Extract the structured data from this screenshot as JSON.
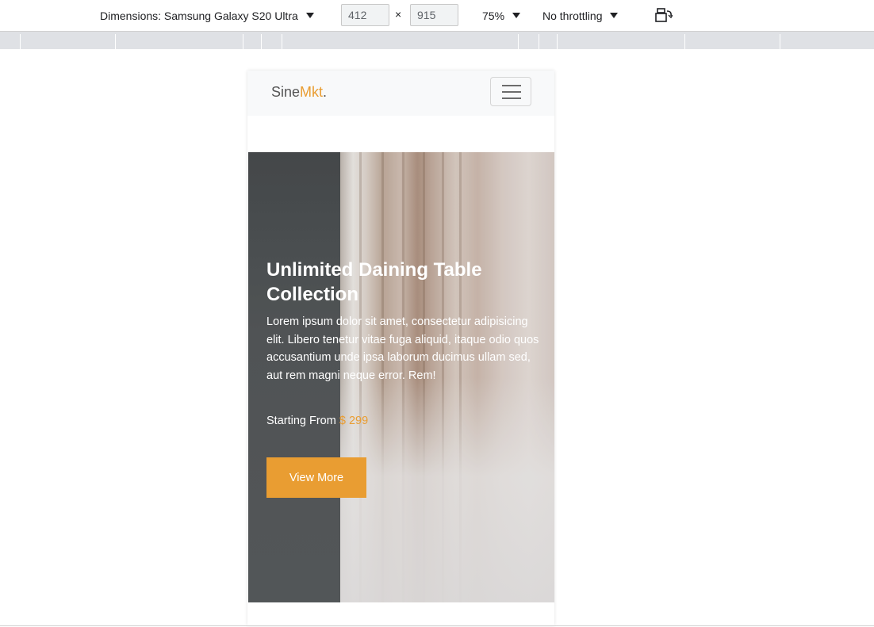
{
  "toolbar": {
    "dimensions_label": "Dimensions: Samsung Galaxy S20 Ultra",
    "width": "412",
    "times": "×",
    "height": "915",
    "zoom": "75%",
    "throttling": "No throttling",
    "rotate_icon": "rotate-icon"
  },
  "page": {
    "brand_main": "Sine",
    "brand_accent": "Mkt",
    "brand_dot": ".",
    "hero": {
      "title": "Unlimited Daining Table Collection",
      "text": "Lorem ipsum dolor sit amet, consectetur adipisicing elit. Libero tenetur vitae fuga aliquid, itaque odio quos accusantium unde ipsa laborum ducimus ullam sed, aut rem magni neque error. Rem!",
      "price_prefix": "Starting From",
      "price": "$ 299",
      "button": "View More"
    }
  },
  "colors": {
    "accent": "#e99d32",
    "navbar_bg": "#f8f9fa",
    "hero_dark": "#575b5d"
  }
}
